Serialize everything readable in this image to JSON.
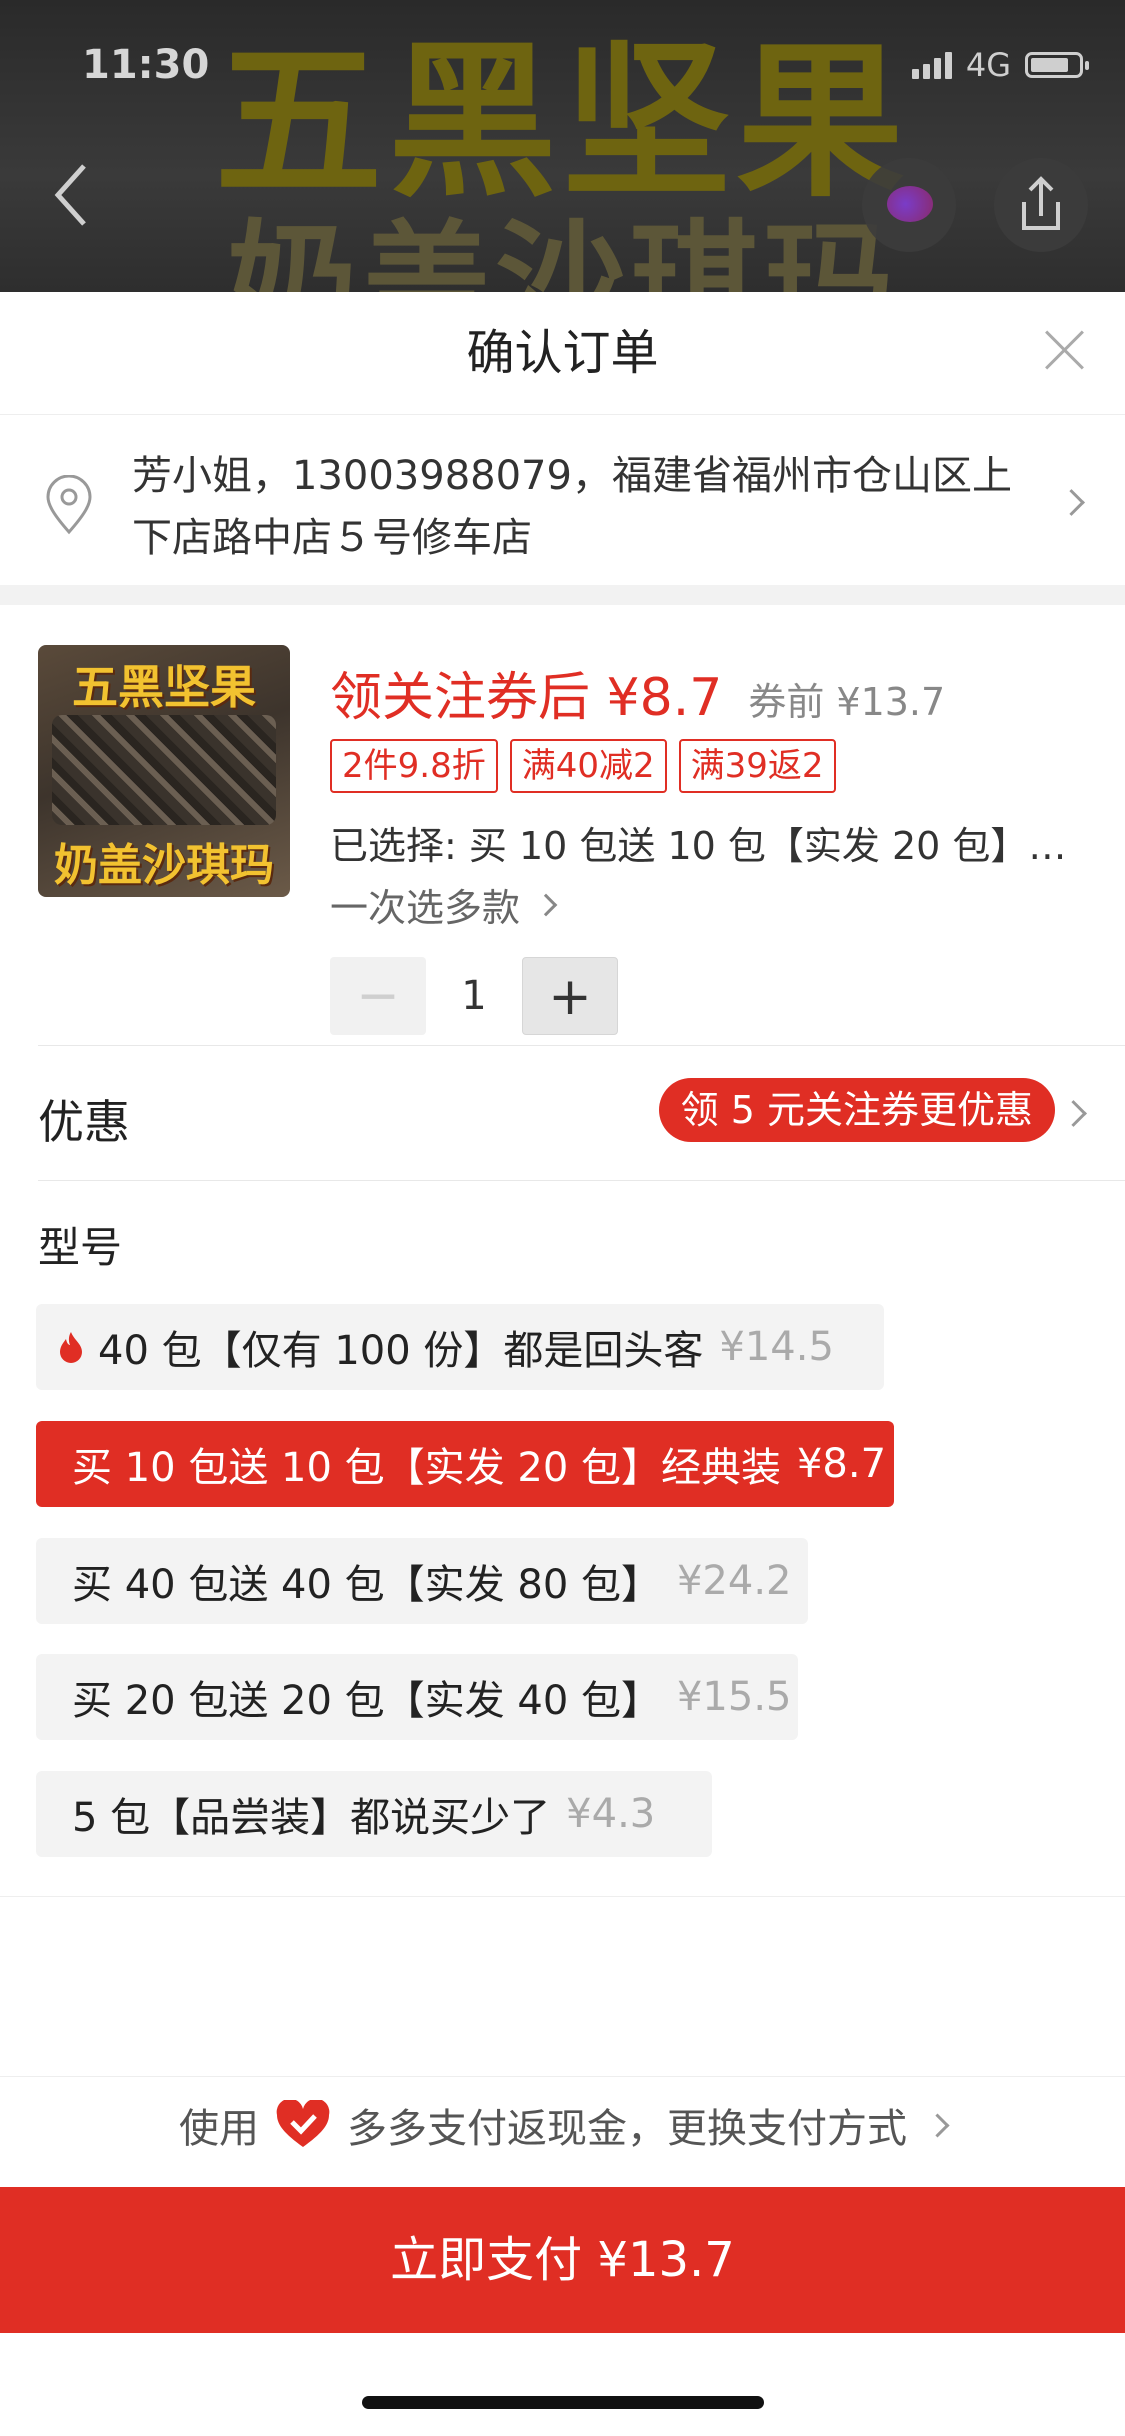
{
  "status": {
    "time": "11:30",
    "network": "4G"
  },
  "banner": {
    "line1": "五黑坚果",
    "line2": "奶盖沙琪玛"
  },
  "sheet": {
    "title": "确认订单"
  },
  "address": {
    "text": "芳小姐，13003988079，福建省福州市仓山区上下店路中店５号修车店"
  },
  "product": {
    "thumb_top": "五黑坚果",
    "thumb_bottom": "奶盖沙琪玛",
    "price_label": "领关注券后 ¥8.7",
    "price_before": "券前 ¥13.7",
    "tags": [
      "2件9.8折",
      "满40减2",
      "满39返2"
    ],
    "selected": "已选择: 买 10 包送 10 包【实发 20 包】经...",
    "multi_select": "一次选多款",
    "quantity": "1",
    "minus": "−",
    "plus": "+"
  },
  "promo": {
    "label": "优惠",
    "pill": "领 5 元关注券更优惠"
  },
  "model": {
    "title": "型号",
    "options": [
      {
        "label": "40 包【仅有 100 份】都是回头客",
        "price": "¥14.5"
      },
      {
        "label": "买 10 包送 10 包【实发 20 包】经典装",
        "price": "¥8.7"
      },
      {
        "label": "买 40 包送 40 包【实发 80 包】",
        "price": "¥24.2"
      },
      {
        "label": "买 20 包送 20 包【实发 40 包】",
        "price": "¥15.5"
      },
      {
        "label": "5 包【品尝装】都说买少了",
        "price": "¥4.3"
      }
    ]
  },
  "payment": {
    "prefix": "使用",
    "suffix": "多多支付返现金，更换支付方式",
    "button": "立即支付 ¥13.7"
  },
  "colors": {
    "accent": "#e02e24"
  }
}
